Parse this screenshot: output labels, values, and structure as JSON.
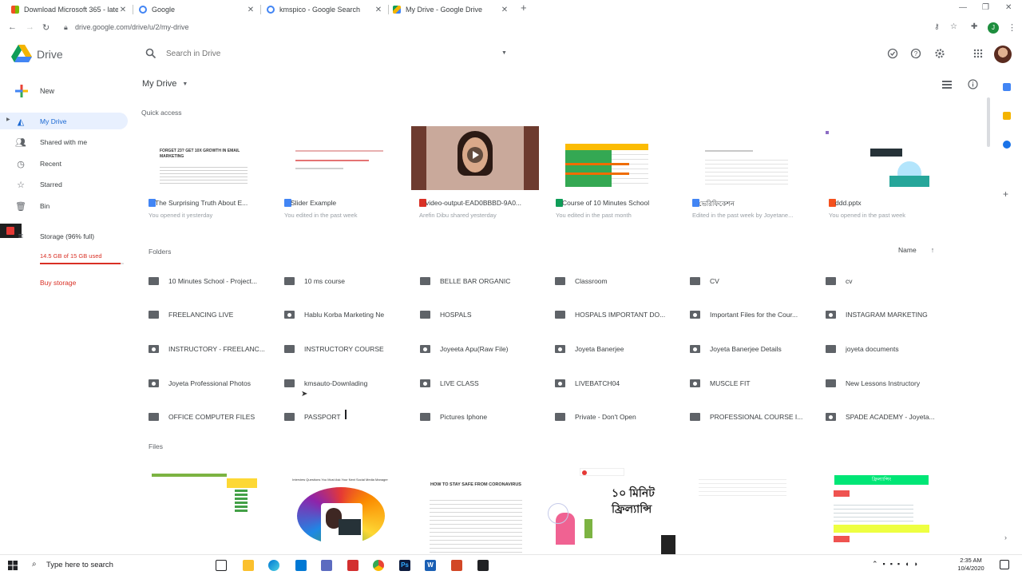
{
  "browser": {
    "tabs": [
      {
        "label": "Download Microsoft 365 - latest",
        "color": "#f25022"
      },
      {
        "label": "Google",
        "color": "#4285f4"
      },
      {
        "label": "kmspico - Google Search",
        "color": "#4285f4"
      },
      {
        "label": "My Drive - Google Drive",
        "color": "#0f9d58"
      }
    ],
    "new_tab": "+",
    "url": "drive.google.com/drive/u/2/my-drive",
    "profile_initial": "J"
  },
  "drive": {
    "app_title": "Drive",
    "search_placeholder": "Search in Drive",
    "breadcrumb": "My Drive",
    "sidebar": {
      "new_label": "New",
      "items": [
        {
          "label": "My Drive"
        },
        {
          "label": "Shared with me"
        },
        {
          "label": "Recent"
        },
        {
          "label": "Starred"
        },
        {
          "label": "Bin"
        },
        {
          "label": "Storage (96% full)"
        }
      ],
      "storage_used": "14.5 GB of 15 GB used",
      "storage_fraction": 0.96,
      "buy_storage": "Buy storage"
    },
    "quick_access_label": "Quick access",
    "quick_access": [
      {
        "name": "The Surprising Truth About E...",
        "sub": "You opened it yesterday",
        "icon_color": "#4285f4",
        "thumb_text": "FORGET 23? GET 10X GROWTH IN EMAIL MARKETING"
      },
      {
        "name": "Slider Example",
        "sub": "You edited in the past week",
        "icon_color": "#4285f4",
        "thumb_text": ""
      },
      {
        "name": "video-output-EAD0BBBD-9A0...",
        "sub": "Arefin Dibu shared yesterday",
        "icon_color": "#d93025",
        "thumb_text": ""
      },
      {
        "name": "Course of 10 Minutes School",
        "sub": "You edited in the past month",
        "icon_color": "#0f9d58",
        "thumb_text": ""
      },
      {
        "name": "ভেরিফিকেশন",
        "sub": "Edited in the past week by Joyetane...",
        "icon_color": "#4285f4",
        "thumb_text": ""
      },
      {
        "name": "ddd.pptx",
        "sub": "You opened in the past week",
        "icon_color": "#f4511e",
        "thumb_text": ""
      }
    ],
    "folders_label": "Folders",
    "sort_label": "Name",
    "sort_arrow": "↑",
    "folders": [
      {
        "name": "10 Minutes School - Project...",
        "shared": false
      },
      {
        "name": "10 ms course",
        "shared": false
      },
      {
        "name": "BELLE BAR ORGANIC",
        "shared": false
      },
      {
        "name": "Classroom",
        "shared": false
      },
      {
        "name": "CV",
        "shared": false
      },
      {
        "name": "cv",
        "shared": false
      },
      {
        "name": "FREELANCING LIVE",
        "shared": false
      },
      {
        "name": "Hablu Korba Marketing Ne",
        "shared": true
      },
      {
        "name": "HOSPALS",
        "shared": false
      },
      {
        "name": "HOSPALS IMPORTANT DO...",
        "shared": false
      },
      {
        "name": "Important Files for the Cour...",
        "shared": true
      },
      {
        "name": "INSTAGRAM MARKETING",
        "shared": true
      },
      {
        "name": "INSTRUCTORY - FREELANC...",
        "shared": true
      },
      {
        "name": "INSTRUCTORY COURSE",
        "shared": false
      },
      {
        "name": "Joyeeta Apu(Raw File)",
        "shared": true
      },
      {
        "name": "Joyeta Banerjee",
        "shared": true
      },
      {
        "name": "Joyeta Banerjee Details",
        "shared": true
      },
      {
        "name": "joyeta documents",
        "shared": false
      },
      {
        "name": "Joyeta Professional Photos",
        "shared": true
      },
      {
        "name": "kmsauto-Downlading",
        "shared": false
      },
      {
        "name": "LIVE CLASS",
        "shared": true
      },
      {
        "name": "LIVEBATCH04",
        "shared": true
      },
      {
        "name": "MUSCLE FIT",
        "shared": true
      },
      {
        "name": "New Lessons Instructory",
        "shared": false
      },
      {
        "name": "OFFICE COMPUTER FILES",
        "shared": false
      },
      {
        "name": "PASSPORT",
        "shared": false
      },
      {
        "name": "Pictures Iphone",
        "shared": false
      },
      {
        "name": "Private - Don't Open",
        "shared": false
      },
      {
        "name": "PROFESSIONAL COURSE I...",
        "shared": false
      },
      {
        "name": "SPADE ACADEMY - Joyeta...",
        "shared": true
      }
    ],
    "files_label": "Files",
    "files": [
      {
        "title": ""
      },
      {
        "title": "Interview Questions You Must Ask Your Next Social Media Manager"
      },
      {
        "title": "HOW TO STAY SAFE FROM CORONAVIRUS"
      },
      {
        "title": "১০ মিনিট ফ্রিল্যান্সি"
      },
      {
        "title": ""
      },
      {
        "title": "ফ্রিল্যান্সিং"
      }
    ]
  },
  "taskbar": {
    "search_placeholder": "Type here to search",
    "time": "2:35 AM",
    "date": "10/4/2020"
  }
}
